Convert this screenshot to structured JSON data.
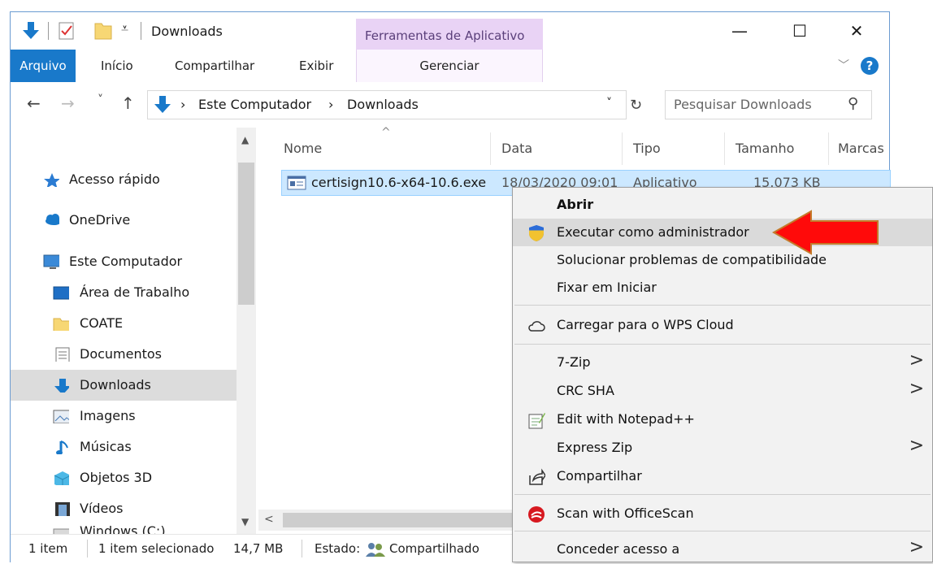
{
  "window": {
    "title": "Downloads",
    "context_tab_group": "Ferramentas de Aplicativo",
    "controls": {
      "minimize": "—",
      "maximize": "☐",
      "close": "✕"
    }
  },
  "ribbon": {
    "tabs": [
      "Arquivo",
      "Início",
      "Compartilhar",
      "Exibir"
    ],
    "context_tab": "Gerenciar",
    "collapse_glyph": "﹀",
    "help_glyph": "?"
  },
  "address": {
    "back": "←",
    "forward": "→",
    "recent": "˅",
    "up": "↑",
    "path": [
      "Este Computador",
      "Downloads"
    ],
    "separator": "›",
    "dropdown": "˅",
    "refresh": "↻",
    "search_placeholder": "Pesquisar Downloads",
    "search_glyph": "⚲"
  },
  "nav": {
    "items": [
      {
        "label": "Acesso rápido",
        "icon": "star-icon"
      },
      {
        "label": "OneDrive",
        "icon": "cloud-icon"
      },
      {
        "label": "Este Computador",
        "icon": "computer-icon"
      },
      {
        "label": "Área de Trabalho",
        "icon": "desktop-icon"
      },
      {
        "label": "COATE",
        "icon": "folder-icon"
      },
      {
        "label": "Documentos",
        "icon": "document-icon"
      },
      {
        "label": "Downloads",
        "icon": "download-icon"
      },
      {
        "label": "Imagens",
        "icon": "image-icon"
      },
      {
        "label": "Músicas",
        "icon": "music-icon"
      },
      {
        "label": "Objetos 3D",
        "icon": "cube-icon"
      },
      {
        "label": "Vídeos",
        "icon": "video-icon"
      },
      {
        "label": "Windows (C:)",
        "icon": "drive-icon"
      }
    ],
    "selected": "Downloads"
  },
  "content": {
    "columns": [
      "Nome",
      "Data",
      "Tipo",
      "Tamanho",
      "Marcas"
    ],
    "sort_glyph": "^",
    "rows": [
      {
        "name": "certisign10.6-x64-10.6.exe",
        "date": "18/03/2020 09:01",
        "type": "Aplicativo",
        "size": "15.073 KB"
      }
    ]
  },
  "status": {
    "count": "1 item",
    "selected": "1 item selecionado",
    "size": "14,7 MB",
    "state_label": "Estado:",
    "state_value": "Compartilhado"
  },
  "context_menu": {
    "items": [
      {
        "label": "Abrir",
        "bold": true
      },
      {
        "label": "Executar como administrador",
        "icon": "shield-icon",
        "highlighted": true
      },
      {
        "label": "Solucionar problemas de compatibilidade"
      },
      {
        "label": "Fixar em Iniciar"
      },
      {
        "label": "Carregar para o WPS Cloud",
        "icon": "cloud-outline-icon"
      },
      {
        "label": "7-Zip",
        "submenu": true
      },
      {
        "label": "CRC SHA",
        "submenu": true
      },
      {
        "label": "Edit with Notepad++",
        "icon": "notepad-icon"
      },
      {
        "label": "Express Zip",
        "submenu": true
      },
      {
        "label": "Compartilhar",
        "icon": "share-icon"
      },
      {
        "label": "Scan with OfficeScan",
        "icon": "officescan-icon"
      },
      {
        "label": "Conceder acesso a",
        "submenu": true
      }
    ],
    "submenu_glyph": ">"
  },
  "colors": {
    "accent": "#1979ca",
    "context_tab": "#e9d3f5",
    "selection": "#cce8ff",
    "arrow": "#ff0000"
  }
}
